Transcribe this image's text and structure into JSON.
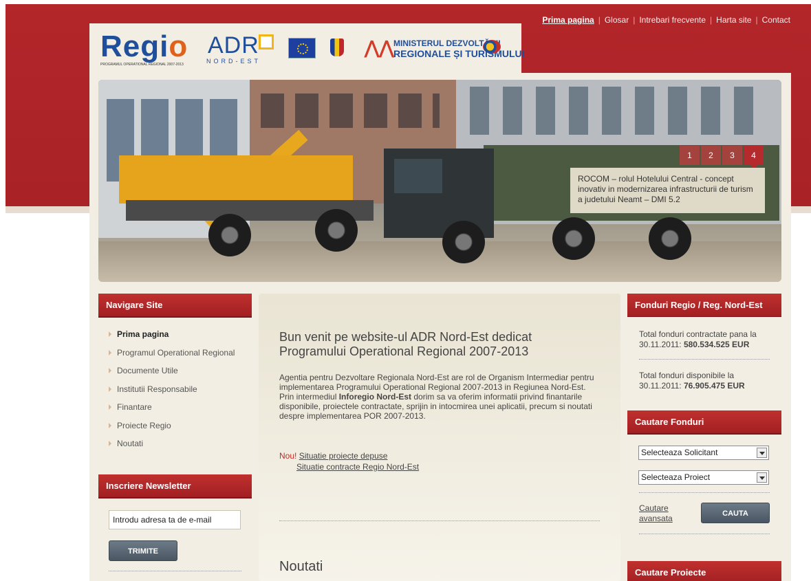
{
  "top_nav": {
    "items": [
      {
        "label": "Prima pagina",
        "active": true
      },
      {
        "label": "Glosar"
      },
      {
        "label": "Intrebari frecvente"
      },
      {
        "label": "Harta site"
      },
      {
        "label": "Contact"
      }
    ]
  },
  "logos": {
    "regio": "Regi",
    "regio_o": "o",
    "regio_sub": "PROGRAMUL OPERATIONAL REGIONAL 2007-2013",
    "adr": "ADR",
    "adr_sub": "NORD-EST",
    "ministry_line1": "MINISTERUL DEZVOLTĂRII",
    "ministry_line2": "REGIONALE ȘI TURISMULUI"
  },
  "slider": {
    "tabs": [
      "1",
      "2",
      "3",
      "4"
    ],
    "active_tab": "4",
    "caption": "ROCOM – rolul Hotelului Central - concept inovativ in modernizarea infrastructurii de turism a judetului Neamt – DMI 5.2"
  },
  "nav": {
    "title": "Navigare Site",
    "items": [
      "Prima pagina",
      "Programul Operational Regional",
      "Documente Utile",
      "Institutii Responsabile",
      "Finantare",
      "Proiecte Regio",
      "Noutati"
    ]
  },
  "newsletter": {
    "title": "Inscriere Newsletter",
    "input_value": "Introdu adresa ta de e-mail",
    "button": "TRIMITE"
  },
  "main": {
    "title": "Bun venit pe website-ul ADR Nord-Est dedicat Programului Operational Regional 2007-2013",
    "text_before": "Agentia pentru Dezvoltare Regionala Nord-Est are rol de Organism Intermediar pentru implementarea Programului Operational Regional 2007-2013 in Regiunea Nord-Est. Prin intermediul ",
    "text_bold": "Inforegio Nord-Est",
    "text_after": " dorim sa va oferim informatii privind finantarile disponibile, proiectele contractate, sprijin in intocmirea unei aplicatii, precum si noutati despre implementarea POR 2007-2013.",
    "nou_label": "Nou!",
    "link1": "Situatie proiecte depuse",
    "link2": "Situatie contracte Regio Nord-Est",
    "news_title": "Noutati"
  },
  "funds": {
    "title": "Fonduri Regio / Reg. Nord-Est",
    "contracted_text": "Total fonduri contractate pana la 30.11.2011: ",
    "contracted_value": "580.534.525 EUR",
    "available_text": "Total fonduri disponibile la 30.11.2011: ",
    "available_value": "76.905.475 EUR"
  },
  "search_funds": {
    "title": "Cautare Fonduri",
    "select1": "Selecteaza Solicitant",
    "select2": "Selecteaza Proiect",
    "advanced_link": "Cautare avansata",
    "button": "CAUTA"
  },
  "search_projects": {
    "title": "Cautare Proiecte"
  },
  "colors": {
    "brand_red": "#b3262a",
    "beige": "#f2eee3",
    "logo_blue": "#1f4e9b"
  }
}
